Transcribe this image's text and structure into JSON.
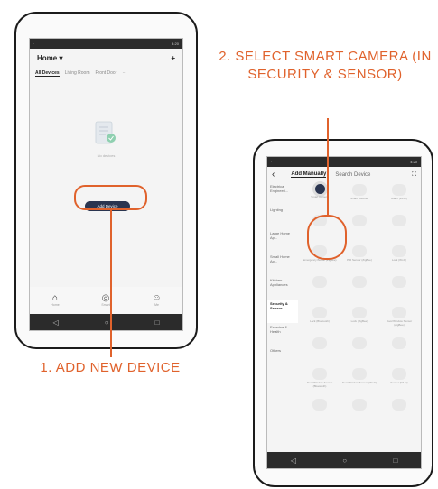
{
  "phone1": {
    "status_time": "4:20",
    "header_title": "Home ▾",
    "add_icon": "+",
    "tabs": [
      "All Devices",
      "Living Room",
      "Front Door",
      "···"
    ],
    "no_devices_text": "No devices",
    "add_device_label": "Add Device",
    "bottom_tabs": [
      {
        "label": "Home",
        "icon": "home-icon",
        "glyph": "⌂"
      },
      {
        "label": "Smart",
        "icon": "smart-icon",
        "glyph": "◎"
      },
      {
        "label": "Me",
        "icon": "profile-icon",
        "glyph": "☺"
      }
    ]
  },
  "phone2": {
    "status_time": "4:20",
    "back_glyph": "‹",
    "add_manually_label": "Add Manually",
    "search_device_label": "Search Device",
    "scan_glyph": "⛶",
    "categories": [
      "Electrical Engineeri...",
      "Lighting",
      "Large Home Ap...",
      "Small Home Ap...",
      "Kitchen Appliances",
      "Security & Sensor",
      "Exercise & Health",
      "Others"
    ],
    "active_category_index": 5,
    "devices": [
      "Smart Camera",
      "Smart Doorbell",
      "Alarm (Wi-Fi)",
      "",
      "",
      "",
      "Emergency Button (ZigBee)",
      "PIR Sensor (ZigBee)",
      "Lock (Wi-Fi)",
      "",
      "",
      "",
      "Lock (Bluetooth)",
      "Lock (ZigBee)",
      "Door/Window Sensor (ZigBee)",
      "",
      "",
      "",
      "Door/Window Sensor (Bluetooth)",
      "Door/Window Sensor (Wi-Fi)",
      "Sensor (Wi-Fi)",
      "",
      "",
      ""
    ],
    "selected_device_index": 0
  },
  "step1_label": "1. ADD NEW DEVICE",
  "step2_label": "2. SELECT SMART CAMERA (IN SECURITY & SENSOR)",
  "accent_color": "#e0622c"
}
